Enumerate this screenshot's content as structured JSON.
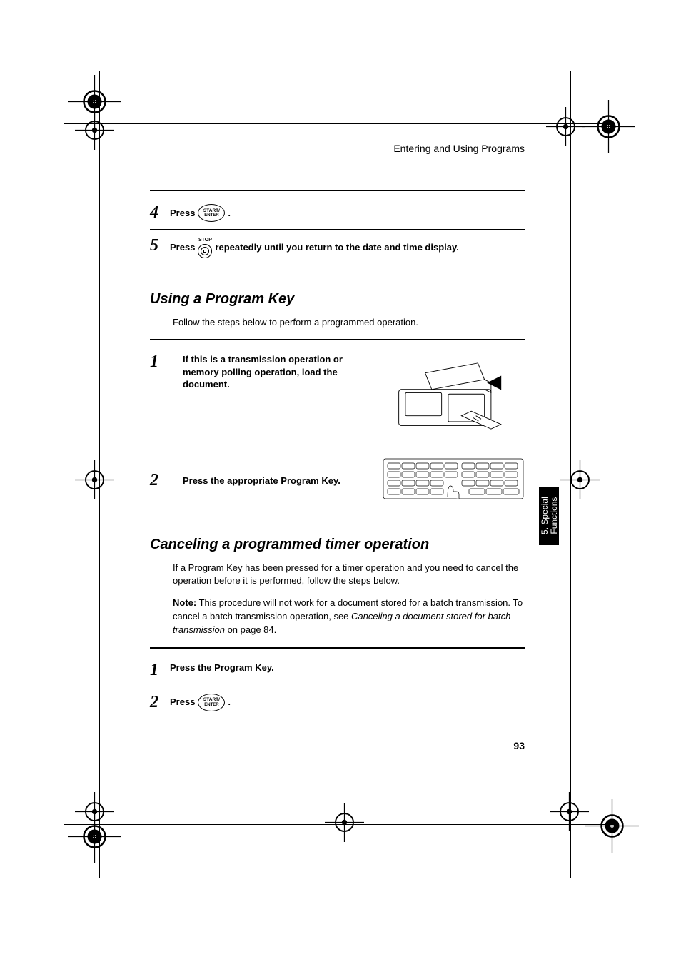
{
  "header": {
    "running_header": "Entering and Using Programs"
  },
  "buttons": {
    "start_enter_line1": "START/",
    "start_enter_line2": "ENTER",
    "stop_label": "STOP"
  },
  "steps_top": {
    "step4": {
      "num": "4",
      "press": "Press",
      "after": " ."
    },
    "step5": {
      "num": "5",
      "press": "Press",
      "after": " repeatedly until you return to the date and time display."
    }
  },
  "section_using": {
    "heading": "Using a Program Key",
    "intro": "Follow the steps below to perform a programmed operation.",
    "step1": {
      "num": "1",
      "text": "If this is a transmission operation or memory polling operation, load the document."
    },
    "step2": {
      "num": "2",
      "text": "Press the appropriate Program Key."
    }
  },
  "section_cancel": {
    "heading": "Canceling a programmed timer operation",
    "intro": "If a Program Key has been pressed for a timer operation and you need to cancel the operation before it is performed, follow the steps below.",
    "note_label": "Note:",
    "note_text_1": " This procedure will not work for a document stored for a batch transmission. To cancel a batch transmission operation, see ",
    "note_italic": "Canceling a document stored for batch transmission",
    "note_text_2": " on page 84.",
    "step1": {
      "num": "1",
      "text": "Press the Program Key."
    },
    "step2": {
      "num": "2",
      "press": "Press",
      "after": "."
    }
  },
  "side_tab": {
    "line1": "5. Special",
    "line2": "Functions"
  },
  "footer": {
    "page_number": "93"
  }
}
